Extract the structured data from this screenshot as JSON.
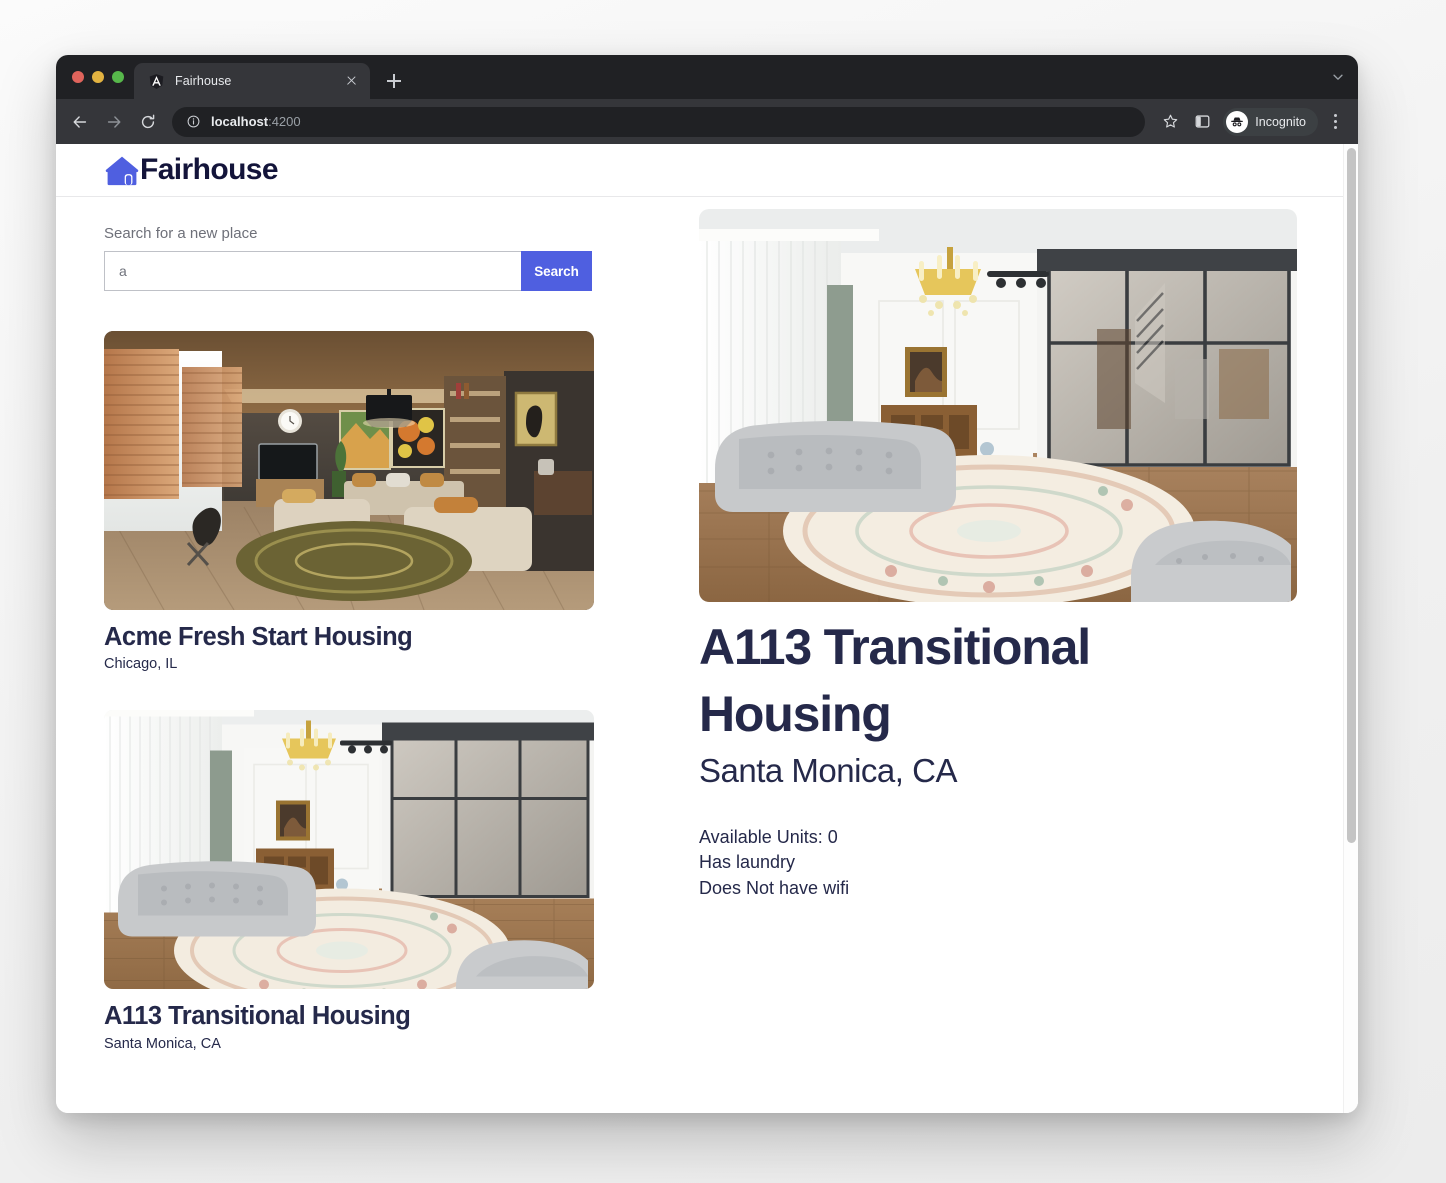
{
  "browser": {
    "traffic_lights": [
      "close",
      "minimize",
      "maximize"
    ],
    "tab": {
      "title": "Fairhouse",
      "favicon": "angular-icon",
      "close_label": "×"
    },
    "new_tab_label": "+",
    "tabstrip_chevron": "chevron-down-icon",
    "toolbar": {
      "back": "back-arrow-icon",
      "forward": "forward-arrow-icon",
      "reload": "reload-icon",
      "site_info": "info-circle-icon",
      "url_host": "localhost",
      "url_port": ":4200",
      "bookmark": "star-icon",
      "side_panel": "side-panel-icon",
      "profile_label": "Incognito",
      "profile_icon": "incognito-hat-icon",
      "menu": "three-dot-menu-icon"
    }
  },
  "app": {
    "brand": {
      "name": "Fairhouse",
      "logo": "house-icon",
      "logo_color": "#4f5fe0",
      "text_color": "#13143a"
    },
    "search": {
      "label": "Search for a new place",
      "value": "a",
      "placeholder": "",
      "button_label": "Search",
      "button_color": "#4f5fe0"
    },
    "listings": [
      {
        "name": "Acme Fresh Start Housing",
        "city": "Chicago, IL",
        "photo": "warm-modern-living-room"
      },
      {
        "name": "A113 Transitional Housing",
        "city": "Santa Monica, CA",
        "photo": "white-classic-living-room"
      }
    ],
    "detail": {
      "name": "A113 Transitional Housing",
      "city": "Santa Monica, CA",
      "photo": "white-classic-living-room",
      "facts": [
        "Available Units: 0",
        "Has laundry",
        "Does Not have wifi"
      ]
    }
  }
}
